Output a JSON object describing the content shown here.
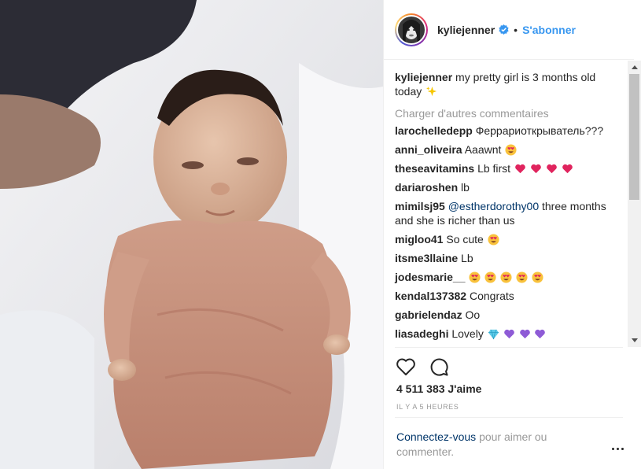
{
  "post": {
    "image_alt": "baby photo",
    "username": "kyliejenner",
    "follow_label": "S'abonner",
    "separator": "•"
  },
  "caption": {
    "username": "kyliejenner",
    "text": "my pretty girl is 3 months old today"
  },
  "load_more": "Charger d'autres commentaires",
  "comments": [
    {
      "user": "larochelledepp",
      "text": "Феррариоткрыватель???"
    },
    {
      "user": "anni_oliveira",
      "text": "Aaawnt"
    },
    {
      "user": "theseavitamins",
      "text": "Lb first"
    },
    {
      "user": "dariaroshen",
      "text": "lb"
    },
    {
      "user": "mimilsj95",
      "mention": "@estherdorothy00",
      "text": "three months and she is richer than us"
    },
    {
      "user": "migloo41",
      "text": "So cute"
    },
    {
      "user": "itsme3llaine",
      "text": "Lb"
    },
    {
      "user": "jodesmarie__",
      "text": ""
    },
    {
      "user": "kendal137382",
      "text": "Congrats"
    },
    {
      "user": "gabrielendaz",
      "text": "Oo"
    },
    {
      "user": "liasadeghi",
      "text": "Lovely"
    }
  ],
  "likes": "4 511 383 J'aime",
  "timestamp": "IL Y A 5 HEURES",
  "login": {
    "link": "Connectez-vous",
    "text": "pour aimer ou commenter."
  },
  "colors": {
    "link_blue": "#3897f0",
    "mention_blue": "#003569",
    "muted": "#999999",
    "text": "#262626"
  },
  "icons": [
    "verified-badge-icon",
    "heart-icon",
    "comment-bubble-icon",
    "more-options-icon",
    "sparkles-emoji",
    "heart-eyes-emoji",
    "red-heart-emoji",
    "diamond-emoji",
    "purple-heart-emoji"
  ]
}
